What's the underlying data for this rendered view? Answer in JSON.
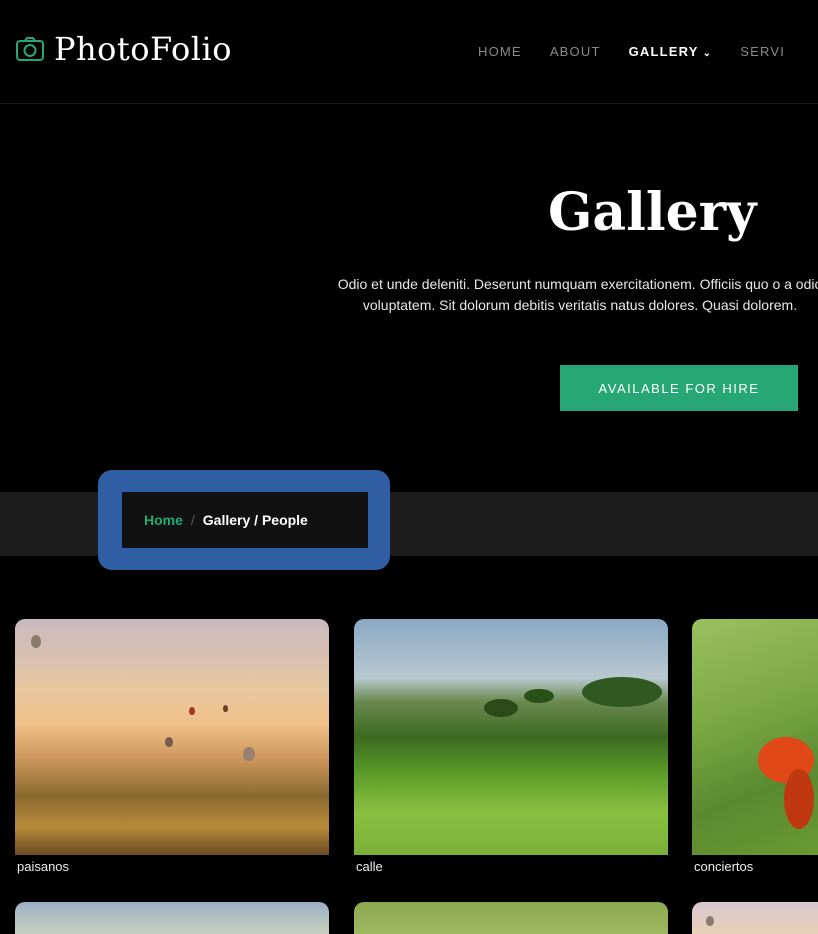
{
  "header": {
    "logo_text": "PhotoFolio",
    "nav": {
      "home": "HOME",
      "about": "ABOUT",
      "gallery": "GALLERY",
      "services": "SERVI"
    }
  },
  "hero": {
    "title": "Gallery",
    "description": "Odio et unde deleniti. Deserunt numquam exercitationem. Officiis quo o a odio voluptatem. Sit dolorum debitis veritatis natus dolores. Quasi dolorem.",
    "button_label": "AVAILABLE FOR HIRE"
  },
  "breadcrumb": {
    "home": "Home",
    "separator": "/",
    "current": "Gallery / People"
  },
  "gallery": {
    "items": [
      {
        "label": "paisanos"
      },
      {
        "label": "calle"
      },
      {
        "label": "conciertos"
      }
    ]
  },
  "colors": {
    "accent": "#27a776",
    "highlight": "#2f5ea3",
    "background": "#000000"
  }
}
